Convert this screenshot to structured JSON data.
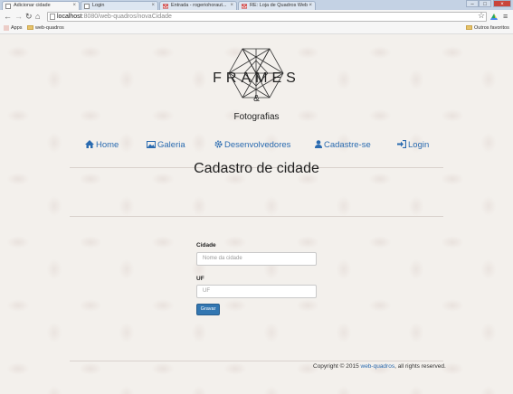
{
  "browser": {
    "tabs": [
      {
        "label": "Adicionar cidade",
        "active": true
      },
      {
        "label": "Login",
        "active": false
      },
      {
        "label": "Entrada - rogeriohoraut...",
        "active": false
      },
      {
        "label": "RE: Loja de Quadros Web -",
        "active": false
      }
    ],
    "url_host": "localhost",
    "url_path": ":8080/web-quadros/novaCidade",
    "bookmarks": {
      "apps": "Apps",
      "folder": "web-quadros",
      "other": "Outros favoritos"
    }
  },
  "brand": {
    "name": "FRAMES",
    "amp": "&",
    "tagline": "Fotografias"
  },
  "menu": {
    "home": "Home",
    "gallery": "Galeria",
    "developers": "Desenvolvedores",
    "signup": "Cadastre-se",
    "login": "Login"
  },
  "page_title": "Cadastro de cidade",
  "form": {
    "city_label": "Cidade",
    "city_placeholder": "Nome da cidade",
    "uf_label": "UF",
    "uf_placeholder": "UF",
    "submit_label": "Gravar"
  },
  "footer": {
    "prefix": "Copyright © 2015 ",
    "link": "web-quadros",
    "suffix": ", all rights reserved."
  },
  "colors": {
    "link": "#2a6bb0",
    "button": "#3276b1"
  }
}
